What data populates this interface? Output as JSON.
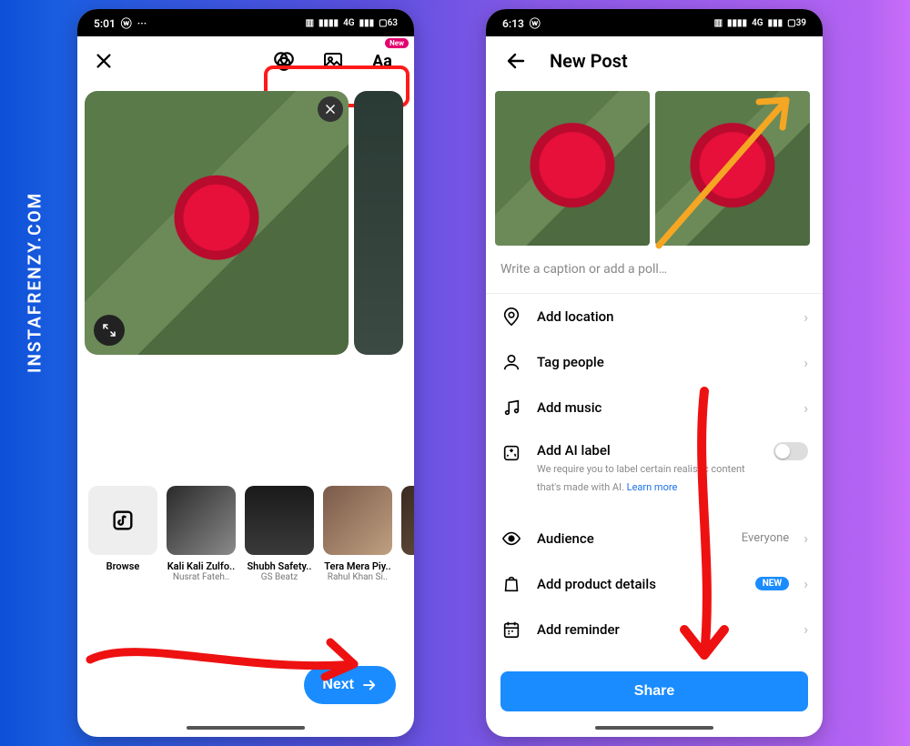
{
  "watermark": "INSTAFRENZY.COM",
  "left": {
    "status_time": "5:01",
    "status_net": "4G",
    "status_batt": "63",
    "new_pill": "New",
    "music": [
      {
        "title": "Browse",
        "subtitle": ""
      },
      {
        "title": "Kali Kali Zulfo..",
        "subtitle": "Nusrat Fateh.."
      },
      {
        "title": "Shubh Safety..",
        "subtitle": "GS Beatz"
      },
      {
        "title": "Tera Mera Piy..",
        "subtitle": "Rahul Khan Si.."
      },
      {
        "title": "",
        "subtitle": ""
      }
    ],
    "next_label": "Next"
  },
  "right": {
    "status_time": "6:13",
    "status_net": "4G",
    "status_batt": "39",
    "title": "New Post",
    "caption_placeholder": "Write a caption or add a poll…",
    "opts": {
      "location": "Add location",
      "tag": "Tag people",
      "music": "Add music",
      "ai": "Add AI label",
      "ai_sub_a": "We require you to label certain realistic content that's made with AI. ",
      "ai_sub_link": "Learn more",
      "audience": "Audience",
      "audience_val": "Everyone",
      "product": "Add product details",
      "product_badge": "NEW",
      "reminder": "Add reminder"
    },
    "share_label": "Share"
  }
}
